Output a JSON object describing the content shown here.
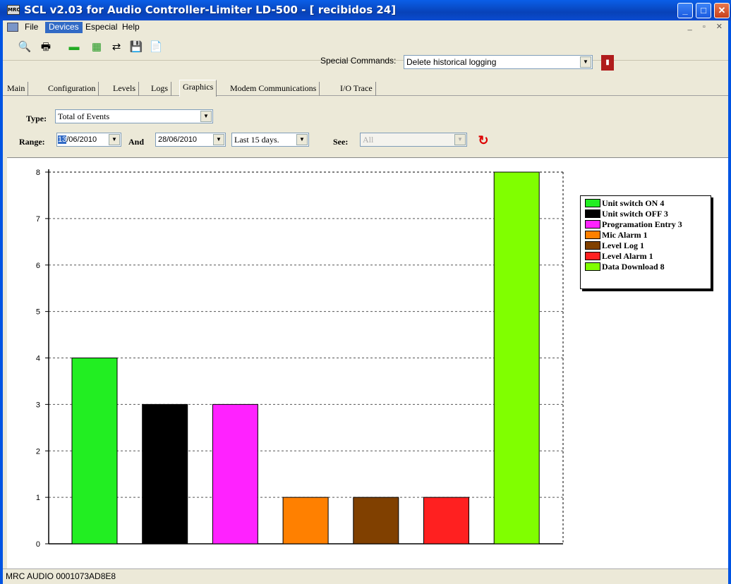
{
  "window": {
    "title": "SCL v2.03 for Audio Controller-Limiter LD-500 - [ recibidos 24]",
    "app_icon_text": "MRC"
  },
  "menu": {
    "items": [
      "File",
      "Devices",
      "Especial",
      "Help"
    ],
    "active": "Devices"
  },
  "toolbar": {
    "icons": [
      "connect-icon",
      "print-icon",
      "device-icon",
      "chip-icon",
      "network-icon",
      "save-icon",
      "document-icon",
      "exit-icon"
    ],
    "special_commands_label": "Special Commands:",
    "special_commands_value": "Delete historical logging"
  },
  "tabs": [
    "Main",
    "Configuration",
    "Levels",
    "Logs",
    "Graphics",
    "Modem Communications",
    "I/O Trace"
  ],
  "active_tab": "Graphics",
  "filters": {
    "type_label": "Type:",
    "type_value": "Total of Events",
    "range_label": "Range:",
    "range_start_day": "13",
    "range_start_rest": "/06/2010",
    "and_label": "And",
    "range_end": "28/06/2010",
    "period": "Last 15 days.",
    "see_label": "See:",
    "see_value": "All"
  },
  "chart_data": {
    "type": "bar",
    "categories": [
      "Unit switch ON",
      "Unit switch OFF",
      "Programation Entry",
      "Mic Alarm",
      "Level Log",
      "Level Alarm",
      "Data Download"
    ],
    "values": [
      4,
      3,
      3,
      1,
      1,
      1,
      8
    ],
    "colors": [
      "#22ee22",
      "#000000",
      "#ff22ff",
      "#ff8000",
      "#804000",
      "#ff2020",
      "#80ff00"
    ],
    "legend": [
      "Unit switch ON 4",
      "Unit switch OFF 3",
      "Programation Entry 3",
      "Mic Alarm 1",
      "Level Log 1",
      "Level Alarm 1",
      "Data Download 8"
    ],
    "ylim": [
      0,
      8
    ],
    "yticks": [
      0,
      1,
      2,
      3,
      4,
      5,
      6,
      7,
      8
    ],
    "grid": true,
    "legend_position": "right"
  },
  "status": {
    "text": "MRC AUDIO 0001073AD8E8"
  }
}
